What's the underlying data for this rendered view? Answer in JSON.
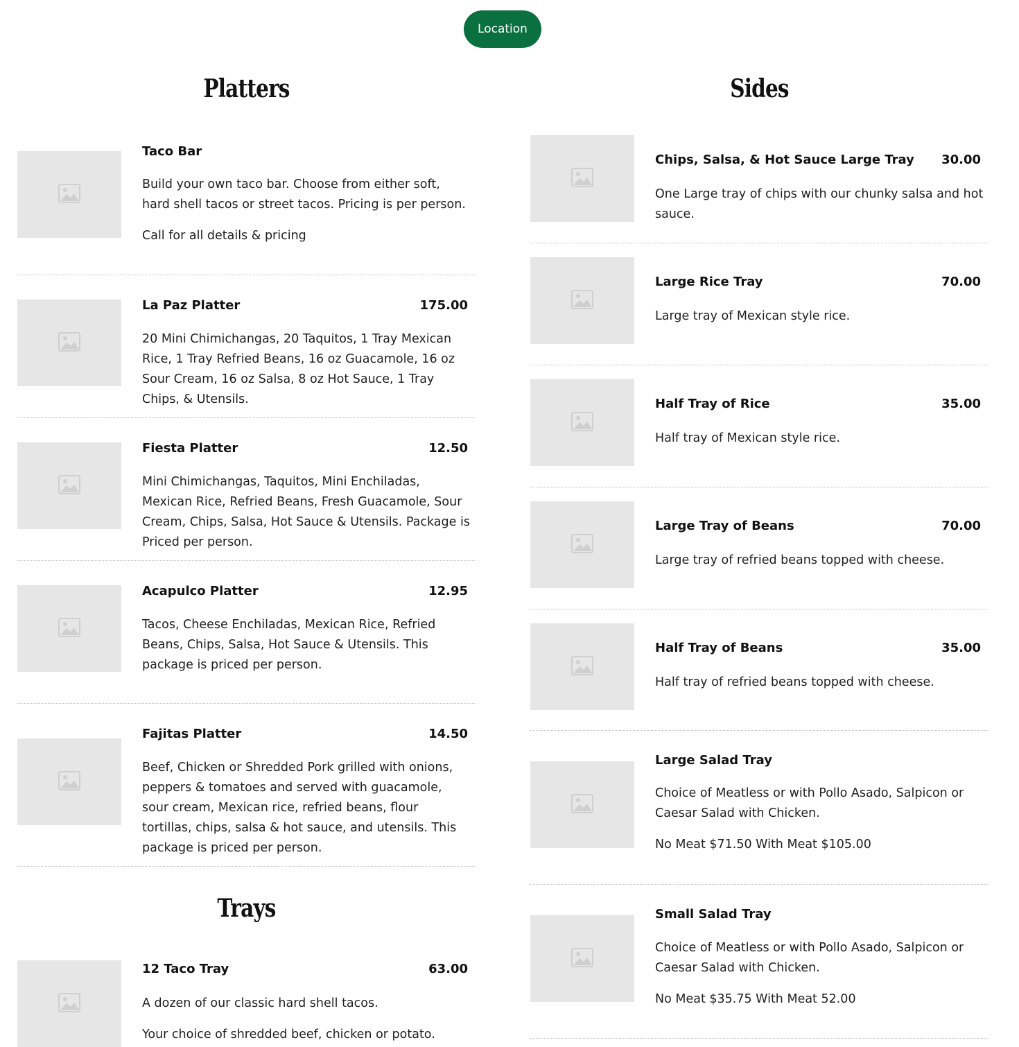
{
  "location_button": "Location",
  "platters": {
    "heading": "Platters",
    "items": [
      {
        "name": "Taco Bar",
        "price": "",
        "desc": "Build your own taco bar. Choose from either soft, hard shell tacos or street tacos. Pricing is per person.",
        "note": "Call for all details & pricing"
      },
      {
        "name": "La Paz Platter",
        "price": "175.00",
        "desc": "20 Mini Chimichangas, 20 Taquitos, 1 Tray Mexican Rice, 1 Tray Refried Beans, 16 oz Guacamole, 16 oz Sour Cream, 16 oz Salsa, 8 oz Hot Sauce, 1 Tray Chips, & Utensils.",
        "note": ""
      },
      {
        "name": "Fiesta Platter",
        "price": "12.50",
        "desc": "Mini Chimichangas, Taquitos, Mini Enchiladas, Mexican Rice, Refried Beans, Fresh Guacamole, Sour Cream, Chips, Salsa, Hot Sauce & Utensils. Package is Priced per person.",
        "note": ""
      },
      {
        "name": "Acapulco Platter",
        "price": "12.95",
        "desc": "Tacos, Cheese Enchiladas, Mexican Rice, Refried Beans, Chips, Salsa, Hot Sauce & Utensils. This package is priced per person.",
        "note": ""
      },
      {
        "name": "Fajitas Platter",
        "price": "14.50",
        "desc": "Beef, Chicken or  Shredded Pork grilled with onions, peppers & tomatoes and served with guacamole, sour cream, Mexican rice, refried beans, flour tortillas, chips, salsa & hot sauce, and utensils. This package is priced per person.",
        "note": ""
      }
    ]
  },
  "trays": {
    "heading": "Trays",
    "items": [
      {
        "name": "12 Taco Tray",
        "price": "63.00",
        "desc": "A dozen of our classic hard shell tacos.",
        "note": "Your choice of shredded beef, chicken or potato."
      }
    ]
  },
  "sides": {
    "heading": "Sides",
    "items": [
      {
        "name": "Chips, Salsa, & Hot Sauce Large Tray",
        "price": "30.00",
        "desc": "One Large tray of chips with our chunky salsa and hot sauce.",
        "note": ""
      },
      {
        "name": "Large Rice Tray",
        "price": "70.00",
        "desc": "Large tray of Mexican style rice.",
        "note": ""
      },
      {
        "name": "Half Tray of Rice",
        "price": "35.00",
        "desc": "Half tray of Mexican style rice.",
        "note": ""
      },
      {
        "name": "Large Tray of Beans",
        "price": "70.00",
        "desc": "Large tray of refried beans topped with cheese.",
        "note": ""
      },
      {
        "name": "Half Tray of Beans",
        "price": "35.00",
        "desc": "Half tray of refried beans topped with cheese.",
        "note": ""
      },
      {
        "name": "Large Salad Tray",
        "price": "",
        "desc": "Choice of Meatless or with Pollo Asado, Salpicon or Caesar Salad with Chicken.",
        "note": "No Meat $71.50 With Meat $105.00"
      },
      {
        "name": "Small Salad Tray",
        "price": "",
        "desc": "Choice of Meatless or with Pollo Asado, Salpicon or Caesar Salad with Chicken.",
        "note": "No Meat $35.75 With Meat 52.00"
      }
    ]
  },
  "image_placeholder_icon": "image-placeholder-icon"
}
